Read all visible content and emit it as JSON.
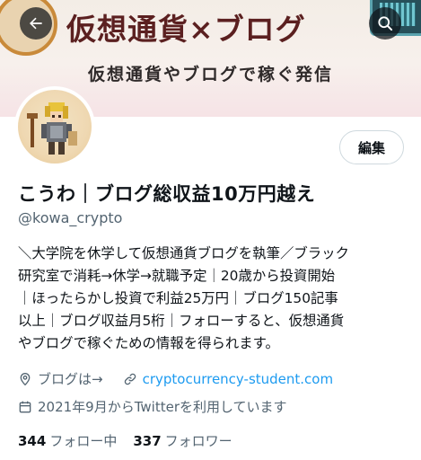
{
  "banner": {
    "title": "仮想通貨×ブログ",
    "subtitle": "仮想通貨やブログで稼ぐ発信"
  },
  "nav": {
    "back_icon": "arrow-left-icon",
    "search_icon": "search-icon"
  },
  "profile": {
    "edit_label": "編集",
    "display_name": "こうわ｜ブログ総収益10万円越え",
    "handle": "@kowa_crypto",
    "bio_lines": [
      "＼大学院を休学して仮想通貨ブログを執筆／ブラック",
      "研究室で消耗→休学→就職予定｜20歳から投資開始",
      "｜ほったらかし投資で利益25万円｜ブログ150記事",
      "以上｜ブログ収益月5桁｜フォローすると、仮想通貨",
      "やブログで稼ぐための情報を得られます。"
    ],
    "location": "ブログは→",
    "link": "cryptocurrency-student.com",
    "joined": "2021年9月からTwitterを利用しています"
  },
  "stats": {
    "following_count": "344",
    "following_label": "フォロー中",
    "followers_count": "337",
    "followers_label": "フォロワー"
  },
  "colors": {
    "link": "#1d9bf0",
    "secondary_text": "#536471",
    "banner_title": "#5b2020"
  }
}
